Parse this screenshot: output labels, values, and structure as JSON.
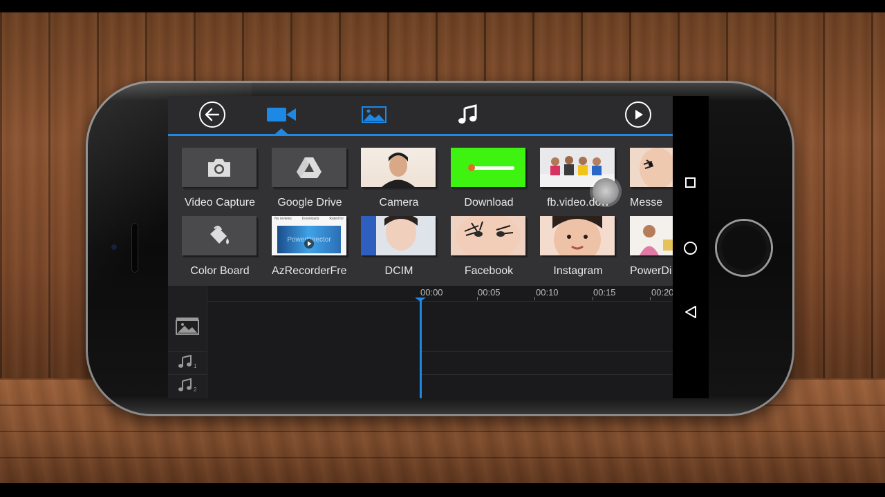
{
  "app": {
    "accent_color": "#1e88e5",
    "topbar": {
      "back_icon": "arrow-left-icon",
      "tabs": [
        {
          "name": "video",
          "icon": "video-camera-icon",
          "active": true
        },
        {
          "name": "photo",
          "icon": "image-icon",
          "active": false
        },
        {
          "name": "music",
          "icon": "music-note-icon",
          "active": false
        }
      ],
      "play_icon": "play-icon"
    },
    "library": {
      "row1": [
        {
          "label": "Video Capture",
          "icon": "camera-icon"
        },
        {
          "label": "Google Drive",
          "icon": "google-drive-icon"
        },
        {
          "label": "Camera"
        },
        {
          "label": "Download"
        },
        {
          "label": "fb.video.dow"
        },
        {
          "label": "Messe"
        }
      ],
      "row2": [
        {
          "label": "Color Board",
          "icon": "paint-bucket-icon"
        },
        {
          "label": "AzRecorderFre"
        },
        {
          "label": "DCIM"
        },
        {
          "label": "Facebook"
        },
        {
          "label": "Instagram"
        },
        {
          "label": "PowerDi"
        }
      ],
      "azrecorder_thumb_text": "PowerDirector",
      "azrecorder_thumb_header": [
        "No reviews",
        "Downloads",
        "Rated for"
      ]
    },
    "timeline": {
      "ticks": [
        "00:00",
        "00:05",
        "00:10",
        "00:15",
        "00:20"
      ],
      "tracks": [
        {
          "icon": "video-track-icon"
        },
        {
          "icon": "music-track-icon",
          "index": "1"
        },
        {
          "icon": "music-track-icon",
          "index": "2"
        }
      ]
    }
  }
}
